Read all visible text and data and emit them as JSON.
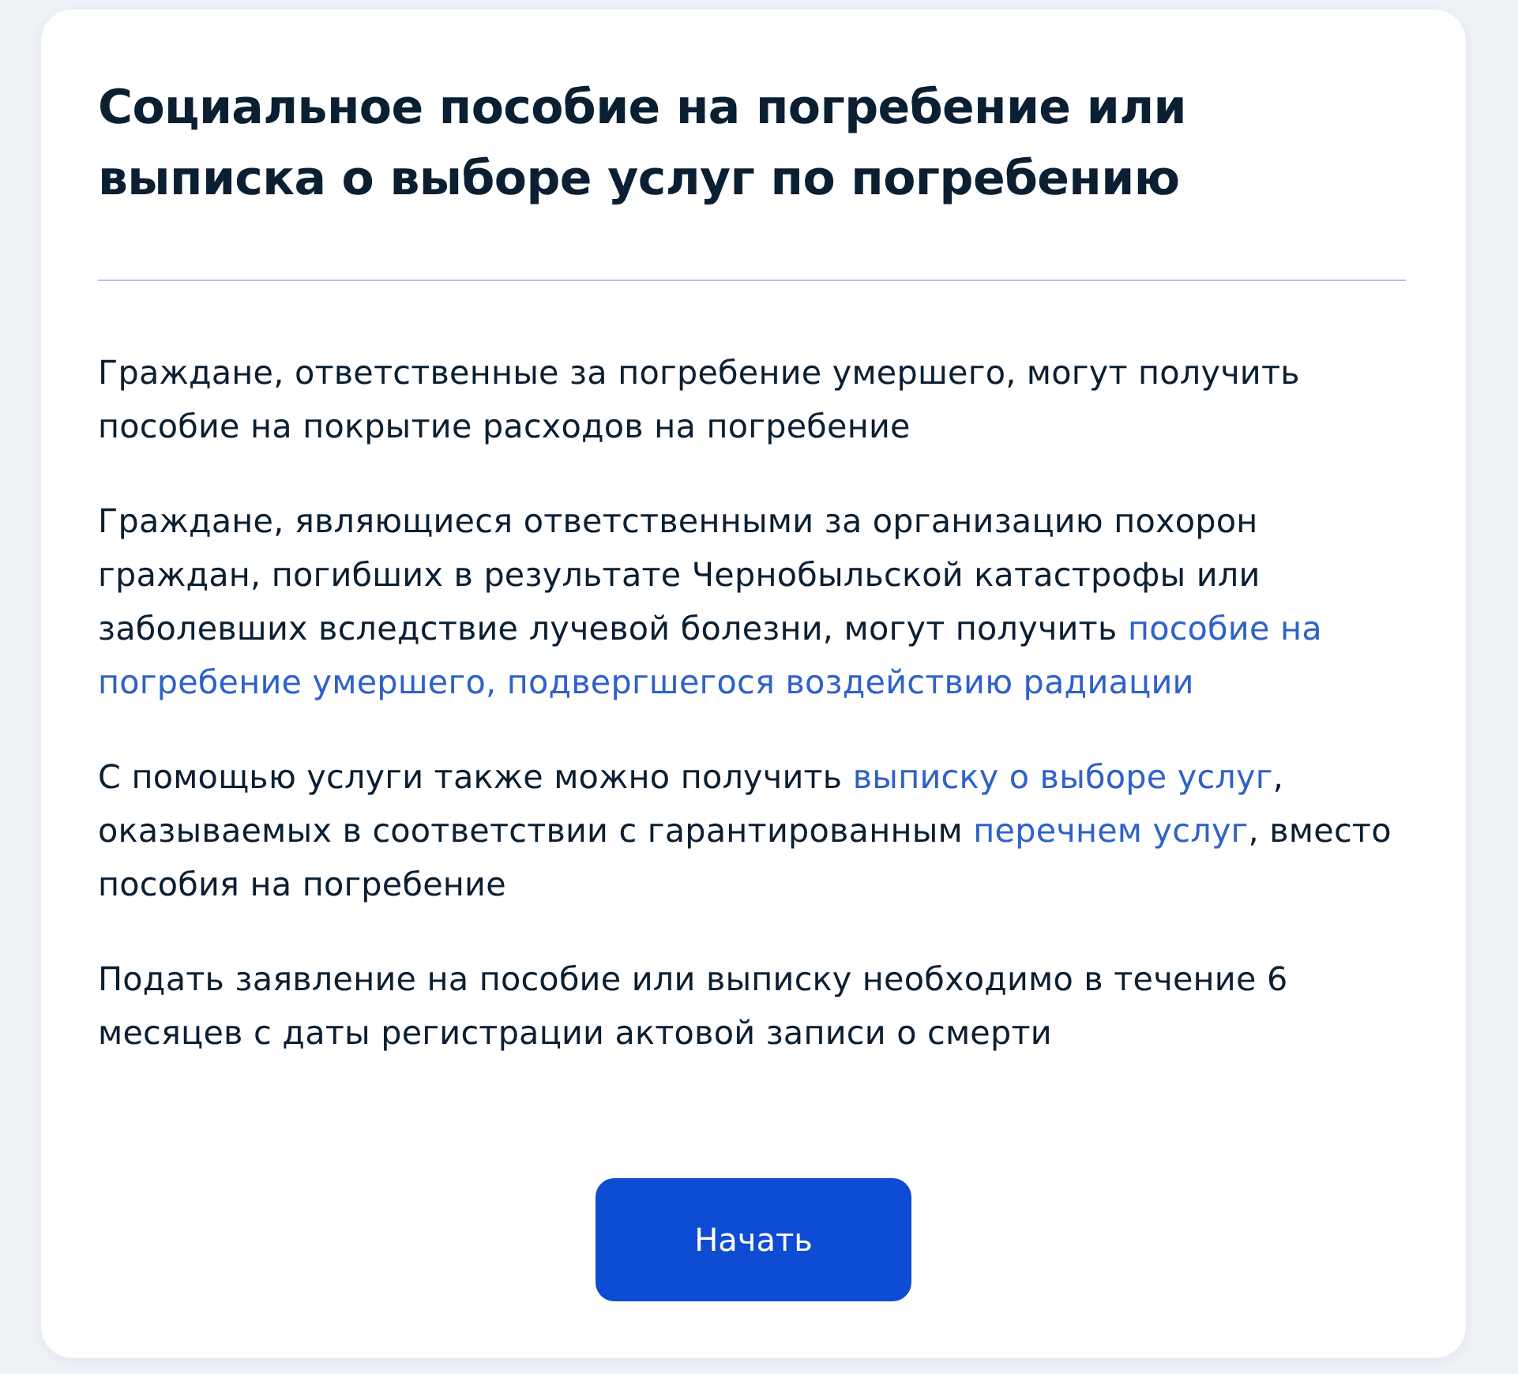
{
  "title": "Социальное пособие на погребение или выписка о выборе услуг по погребению",
  "paragraphs": [
    {
      "segments": [
        {
          "kind": "text",
          "text": "Граждане, ответственные за погребение умершего, могут получить пособие на покрытие расходов на погребение"
        }
      ]
    },
    {
      "segments": [
        {
          "kind": "text",
          "text": "Граждане, являющиеся ответственными за организацию похорон граждан, погибших в результате Чернобыльской катастрофы или заболевших вследствие лучевой болезни, могут получить "
        },
        {
          "kind": "link",
          "lines": [
            "пособие на",
            "погребение умершего, подвергшегося воздействию радиации"
          ]
        }
      ]
    },
    {
      "segments": [
        {
          "kind": "text",
          "text": "С помощью услуги также можно получить "
        },
        {
          "kind": "link",
          "lines": [
            "выписку о выборе услуг"
          ]
        },
        {
          "kind": "text",
          "text": ", оказываемых в соответствии с гарантированным "
        },
        {
          "kind": "link",
          "lines": [
            "перечнем услуг"
          ]
        },
        {
          "kind": "text",
          "text": ", вместо пособия на погребение"
        }
      ]
    },
    {
      "segments": [
        {
          "kind": "text",
          "text": "Подать заявление на пособие или выписку необходимо в течение 6 месяцев с даты регистрации актовой записи о смерти"
        }
      ]
    }
  ],
  "button": {
    "label": "Начать"
  }
}
